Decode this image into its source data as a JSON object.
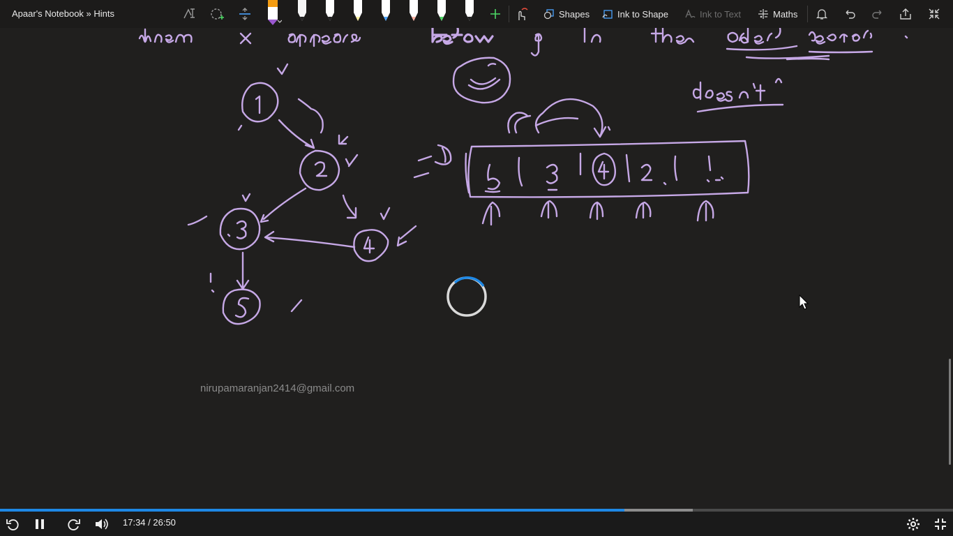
{
  "notebook": {
    "title": "Apaar's Notebook » Hints"
  },
  "toolbar": {
    "shapes_label": "Shapes",
    "ink_to_shape_label": "Ink to Shape",
    "ink_to_text_label": "Ink to Text",
    "maths_label": "Maths",
    "pen_colors": [
      "#f5f5f5",
      "#f7c9e8",
      "#ffffff",
      "#fff4a3",
      "#4aa3ff",
      "#ffb3a3",
      "#4cd964",
      "#ffffff"
    ],
    "active_pen_color": "#9b59d0",
    "active_pen_top_color": "#f39c12"
  },
  "canvas": {
    "ink_color": "#c6a8e6",
    "watermark": "nirupamaranjan2414@gmail.com",
    "handwriting": {
      "line1": "then x appears before y in the order vector.",
      "note": "doesn't",
      "nodes": [
        "1",
        "2",
        "3",
        "4",
        "5"
      ],
      "order_cells": [
        "5",
        "3",
        "4",
        "2",
        "1"
      ]
    }
  },
  "player": {
    "time": "17:34 / 26:50",
    "progress_percent": 65.5,
    "buffered_percent": 72.7,
    "progress_color": "#1e88e5"
  }
}
